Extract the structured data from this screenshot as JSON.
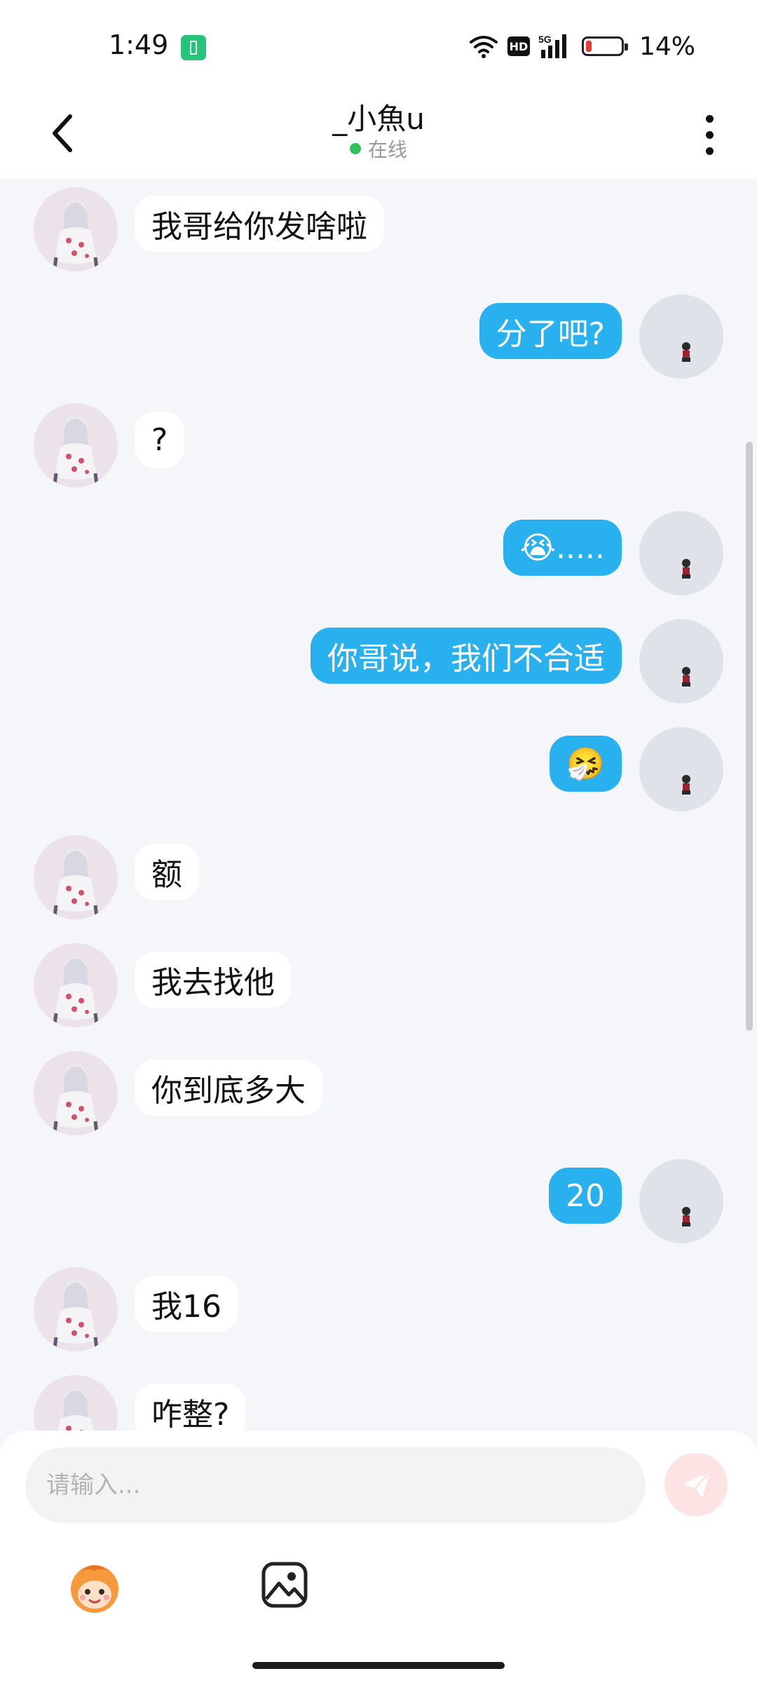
{
  "status_bar": {
    "time": "1:49",
    "battery_percent": "14%",
    "network_label": "5G",
    "hd_label": "HD"
  },
  "header": {
    "title": "_小魚u",
    "status": "在线"
  },
  "messages": [
    {
      "side": "left",
      "text": "我哥给你发啥啦"
    },
    {
      "side": "right",
      "text": "分了吧?"
    },
    {
      "side": "left",
      "text": "?"
    },
    {
      "side": "right",
      "text": "😭....."
    },
    {
      "side": "right",
      "text": "你哥说，我们不合适"
    },
    {
      "side": "right",
      "text": "🤧"
    },
    {
      "side": "left",
      "text": "额"
    },
    {
      "side": "left",
      "text": "我去找他"
    },
    {
      "side": "left",
      "text": "你到底多大"
    },
    {
      "side": "right",
      "text": "20"
    },
    {
      "side": "left",
      "text": "我16"
    },
    {
      "side": "left",
      "text": "咋整?"
    }
  ],
  "composer": {
    "placeholder": "请输入..."
  },
  "colors": {
    "accent_bubble": "#29b1ef",
    "online_dot": "#2fc15a",
    "send_button": "#fde3e3"
  },
  "icons": {
    "back": "chevron-left-icon",
    "more": "more-vertical-icon",
    "send": "paper-plane-icon",
    "mascot": "monkey-mascot-icon",
    "image": "image-gallery-icon"
  }
}
